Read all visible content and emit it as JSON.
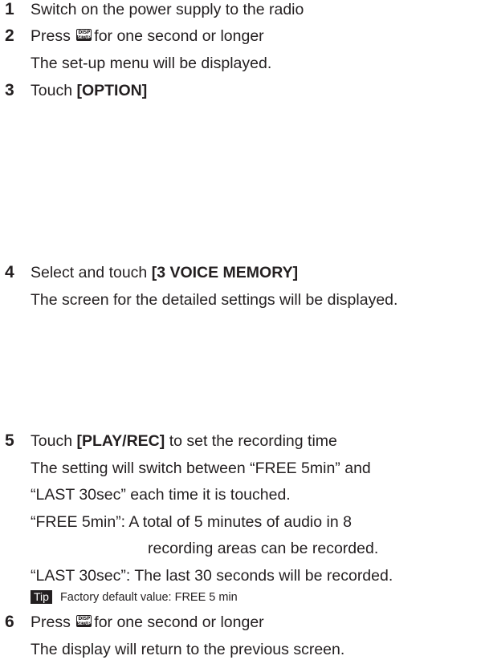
{
  "steps": [
    {
      "number": "1",
      "text": "Switch on the power supply to the radio"
    },
    {
      "number": "2",
      "pre": "Press",
      "key_top": "DISP",
      "key_bottom": "SETUP",
      "post": "for one second or longer",
      "note": "The set-up menu will be displayed."
    },
    {
      "number": "3",
      "pre": "Touch",
      "bold": "[OPTION]"
    },
    {
      "number": "4",
      "pre": "Select and touch",
      "bold": "[3 VOICE MEMORY]",
      "note": "The screen for the detailed settings will be displayed."
    },
    {
      "number": "5",
      "pre": "Touch",
      "bold": "[PLAY/REC]",
      "post": "to set the recording time",
      "notes": [
        "The setting will switch between “FREE 5min” and",
        "“LAST 30sec” each time it is touched.",
        "“FREE 5min”: A total of 5 minutes of audio in 8",
        "recording areas can be recorded.",
        "“LAST 30sec”: The last 30 seconds will be recorded."
      ],
      "tip": {
        "label": "Tip",
        "text": "Factory default value: FREE 5 min"
      }
    },
    {
      "number": "6",
      "pre": "Press",
      "key_top": "DISP",
      "key_bottom": "SETUP",
      "post": "for one second or longer",
      "note": "The display will return to the previous screen."
    }
  ]
}
